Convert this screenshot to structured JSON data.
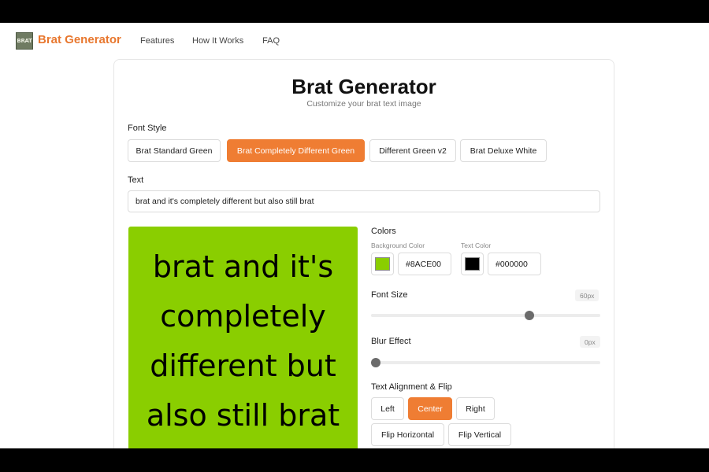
{
  "nav": {
    "logo_text": "BRAT",
    "brand": "Brat Generator",
    "links": [
      "Features",
      "How It Works",
      "FAQ"
    ]
  },
  "card": {
    "title": "Brat Generator",
    "subtitle": "Customize your brat text image"
  },
  "font_style": {
    "label": "Font Style",
    "options": [
      "Brat Standard Green",
      "Brat Completely Different Green",
      "Different Green v2",
      "Brat Deluxe White"
    ],
    "selected": "Brat Completely Different Green"
  },
  "text": {
    "label": "Text",
    "value": "brat and it's completely different but also still brat"
  },
  "preview": {
    "text": "brat and it's completely different but also still brat",
    "background": "#8ACE00",
    "text_color": "#000000"
  },
  "colors": {
    "label": "Colors",
    "background_label": "Background Color",
    "background_value": "#8ACE00",
    "text_label": "Text Color",
    "text_value": "#000000"
  },
  "font_size": {
    "label": "Font Size",
    "value": "60px",
    "fraction": 0.7
  },
  "blur": {
    "label": "Blur Effect",
    "value": "0px",
    "fraction": 0.0
  },
  "alignment": {
    "label": "Text Alignment & Flip",
    "options": [
      "Left",
      "Center",
      "Right"
    ],
    "selected": "Center",
    "flip": [
      "Flip Horizontal",
      "Flip Vertical"
    ]
  },
  "accent_color": "#EF7D33"
}
